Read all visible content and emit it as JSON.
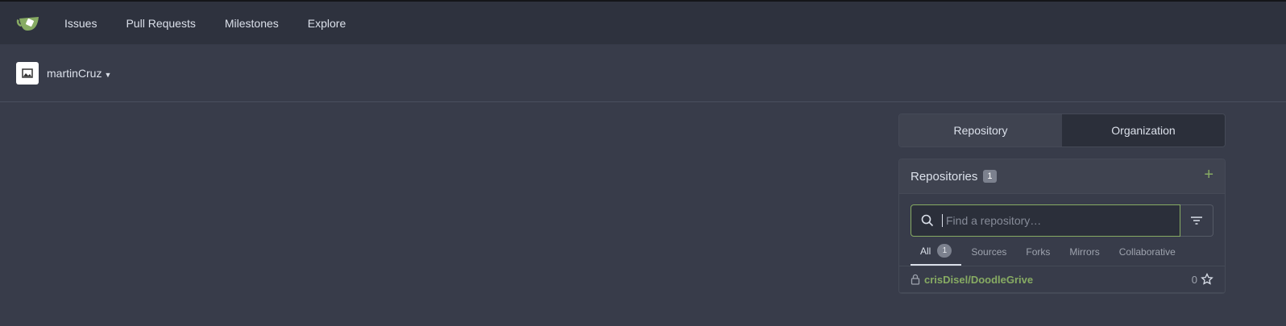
{
  "topbar": {
    "logo_icon": "gitea-teacup-icon",
    "nav": [
      "Issues",
      "Pull Requests",
      "Milestones",
      "Explore"
    ]
  },
  "context": {
    "user": "martinCruz"
  },
  "switcher": {
    "repository": "Repository",
    "organization": "Organization"
  },
  "repos": {
    "title": "Repositories",
    "count": "1",
    "search_placeholder": "Find a repository…",
    "tabs": {
      "all": "All",
      "all_count": "1",
      "sources": "Sources",
      "forks": "Forks",
      "mirrors": "Mirrors",
      "collaborative": "Collaborative"
    },
    "items": [
      {
        "name": "crisDisel/DoodleGrive",
        "stars": "0",
        "private": true
      }
    ]
  },
  "colors": {
    "accent": "#87ab63",
    "bg": "#383c4a",
    "topbar": "#2e323e"
  }
}
